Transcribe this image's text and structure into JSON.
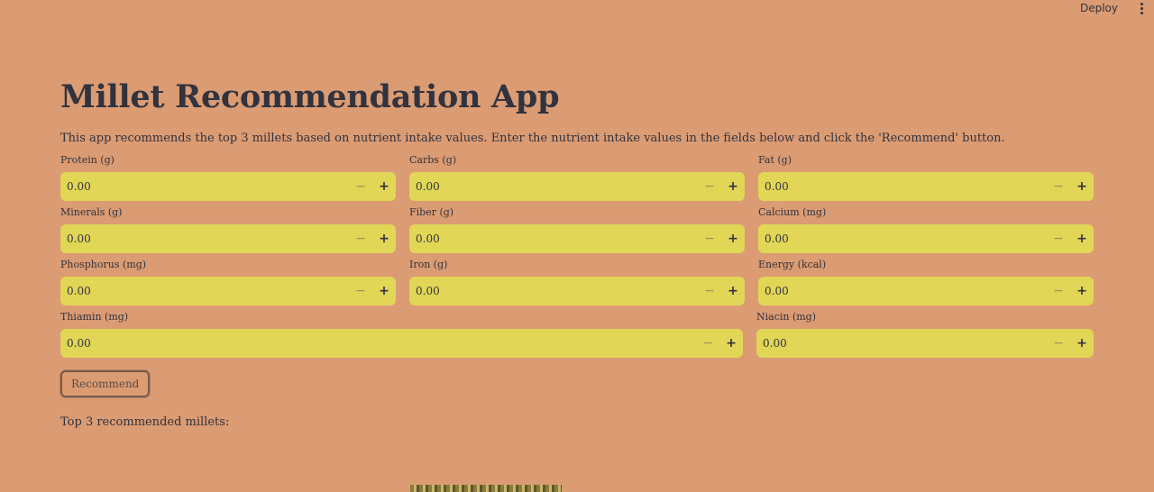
{
  "header": {
    "deploy_label": "Deploy",
    "menu_icon": "kebab-menu-icon"
  },
  "app": {
    "title": "Millet Recommendation App",
    "description": "This app recommends the top 3 millets based on nutrient intake values. Enter the nutrient intake values in the fields below and click the 'Recommend' button."
  },
  "fields": [
    {
      "label": "Protein (g)",
      "value": "0.00"
    },
    {
      "label": "Carbs (g)",
      "value": "0.00"
    },
    {
      "label": "Fat (g)",
      "value": "0.00"
    },
    {
      "label": "Minerals (g)",
      "value": "0.00"
    },
    {
      "label": "Fiber (g)",
      "value": "0.00"
    },
    {
      "label": "Calcium (mg)",
      "value": "0.00"
    },
    {
      "label": "Phosphorus (mg)",
      "value": "0.00"
    },
    {
      "label": "Iron (g)",
      "value": "0.00"
    },
    {
      "label": "Energy (kcal)",
      "value": "0.00"
    },
    {
      "label": "Thiamin (mg)",
      "value": "0.00"
    },
    {
      "label": "Niacin (mg)",
      "value": "0.00"
    }
  ],
  "stepper": {
    "minus": "−",
    "plus": "+"
  },
  "recommend_button": "Recommend",
  "results": {
    "label": "Top 3 recommended millets:"
  },
  "colors": {
    "background": "#db9b73",
    "input_bg": "#e1d655",
    "text": "#31333f"
  }
}
